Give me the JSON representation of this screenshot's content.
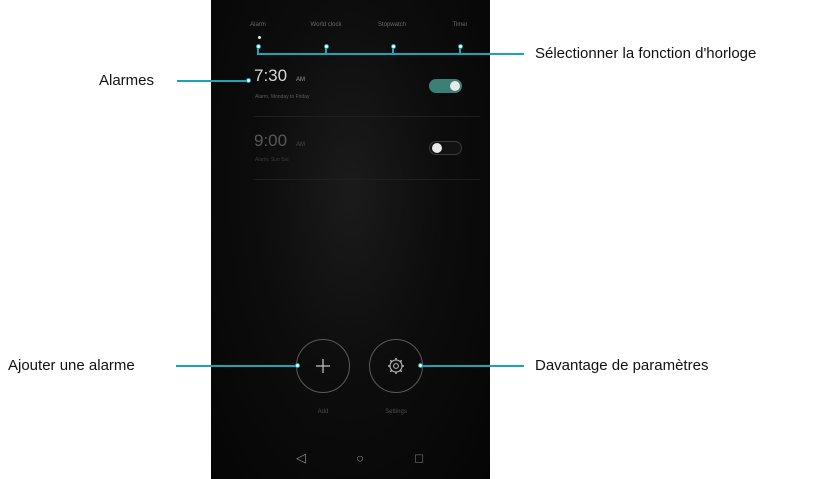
{
  "tabs": [
    "Alarm",
    "World clock",
    "Stopwatch",
    "Timer"
  ],
  "alarms": [
    {
      "time": "7:30",
      "ampm": "AM",
      "repeat": "Alarm, Monday to Friday",
      "enabled": true
    },
    {
      "time": "9:00",
      "ampm": "AM",
      "repeat": "Alarm, Sun Sat",
      "enabled": false
    }
  ],
  "actions": {
    "add_label": "Add",
    "settings_label": "Settings"
  },
  "callouts": {
    "select_function": "Sélectionner la fonction d'horloge",
    "alarms": "Alarmes",
    "add_alarm": "Ajouter une alarme",
    "more_settings": "Davantage de paramètres"
  },
  "colors": {
    "callout": "#1aa5b4",
    "toggle_on": "#3c7f76"
  }
}
